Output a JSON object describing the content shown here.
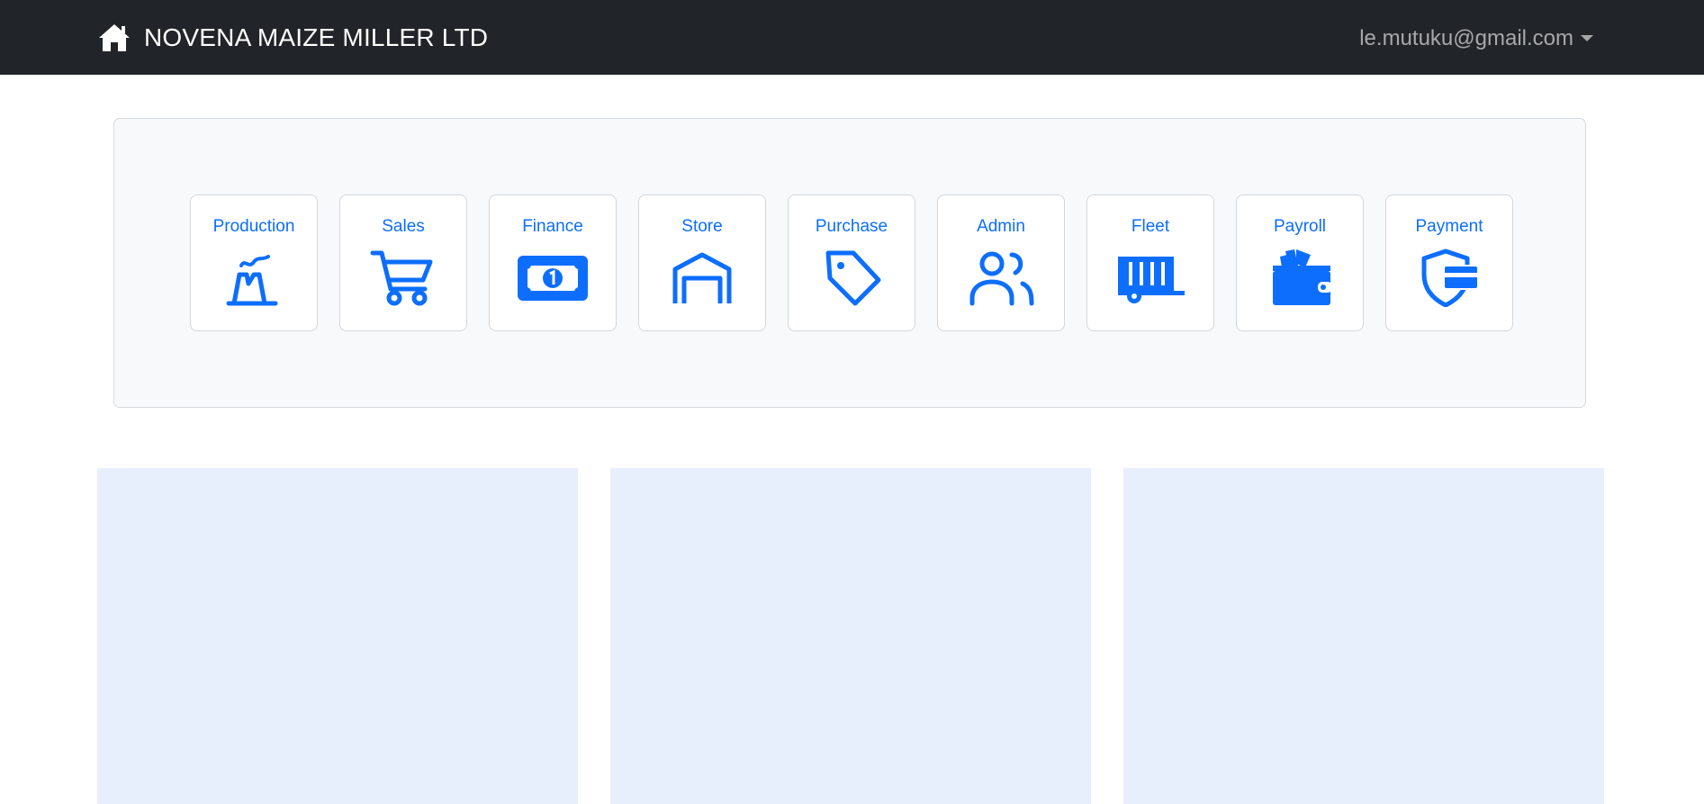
{
  "navbar": {
    "brand": "NOVENA MAIZE MILLER LTD",
    "user_email": "le.mutuku@gmail.com",
    "background": "#212529"
  },
  "modules": [
    {
      "label": "Production",
      "icon": "factory-icon"
    },
    {
      "label": "Sales",
      "icon": "cart-icon"
    },
    {
      "label": "Finance",
      "icon": "banknote-icon"
    },
    {
      "label": "Store",
      "icon": "warehouse-icon"
    },
    {
      "label": "Purchase",
      "icon": "tag-icon"
    },
    {
      "label": "Admin",
      "icon": "users-icon"
    },
    {
      "label": "Fleet",
      "icon": "truck-icon"
    },
    {
      "label": "Payroll",
      "icon": "wallet-icon"
    },
    {
      "label": "Payment",
      "icon": "shield-card-icon"
    }
  ],
  "colors": {
    "accent": "#0d6efd",
    "panel_bg": "#f8f9fa",
    "tile_bg": "#e7eefc"
  }
}
